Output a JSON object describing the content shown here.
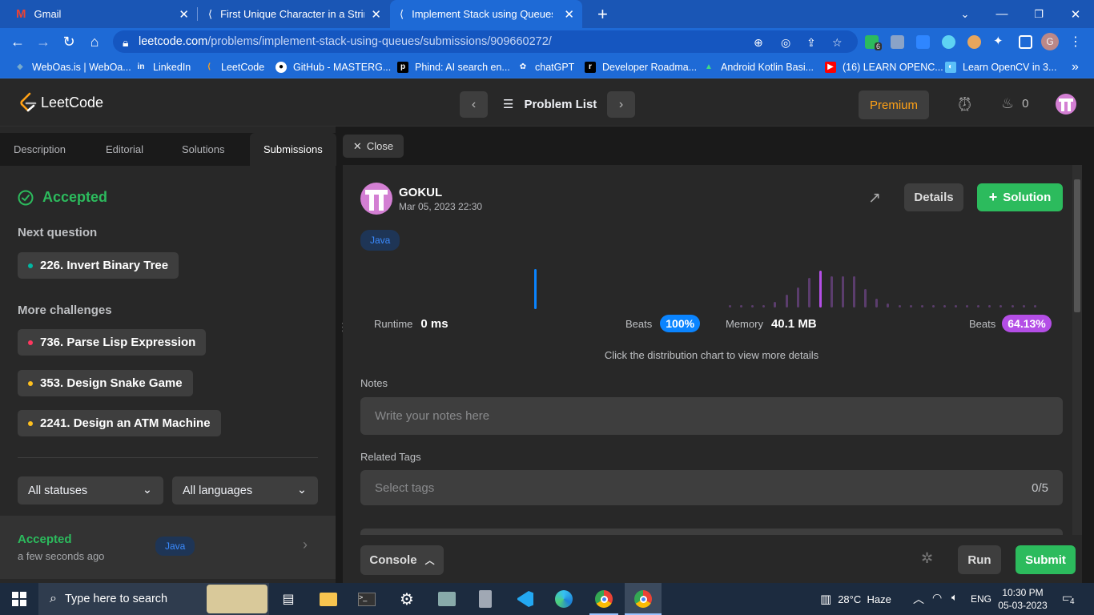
{
  "browser": {
    "tabs": [
      {
        "title": "Gmail"
      },
      {
        "title": "First Unique Character in a String"
      },
      {
        "title": "Implement Stack using Queues -"
      }
    ],
    "url_host": "leetcode.com",
    "url_path": "/problems/implement-stack-using-queues/submissions/909660272/",
    "extension_badge": "6",
    "profile_initial": "G",
    "bookmarks": [
      "WebOas.is | WebOa...",
      "LinkedIn",
      "LeetCode",
      "GitHub - MASTERG...",
      "Phind: AI search en...",
      "chatGPT",
      "Developer Roadma...",
      "Android Kotlin Basi...",
      "(16) LEARN OPENC...",
      "Learn OpenCV in 3..."
    ]
  },
  "header": {
    "logo": "LeetCode",
    "problem_list": "Problem List",
    "premium": "Premium",
    "streak": "0"
  },
  "left_panel": {
    "tabs": [
      "Description",
      "Editorial",
      "Solutions",
      "Submissions"
    ],
    "status": "Accepted",
    "next_question_heading": "Next question",
    "next_question": "226. Invert Binary Tree",
    "more_challenges_heading": "More challenges",
    "challenges": [
      {
        "label": "736. Parse Lisp Expression",
        "color": "#ff375f"
      },
      {
        "label": "353. Design Snake Game",
        "color": "#ffc01e"
      },
      {
        "label": "2241. Design an ATM Machine",
        "color": "#ffc01e"
      }
    ],
    "filter_status": "All statuses",
    "filter_language": "All languages",
    "submission": {
      "status": "Accepted",
      "time": "a few seconds ago",
      "language": "Java"
    }
  },
  "close_button": "Close",
  "submission_detail": {
    "user": "GOKUL",
    "date": "Mar 05, 2023 22:30",
    "details_button": "Details",
    "solution_button": "Solution",
    "language": "Java",
    "runtime_label": "Runtime",
    "runtime_value": "0 ms",
    "runtime_beats_label": "Beats",
    "runtime_beats": "100%",
    "memory_label": "Memory",
    "memory_value": "40.1 MB",
    "memory_beats_label": "Beats",
    "memory_beats": "64.13%",
    "chart_hint": "Click the distribution chart to view more details",
    "notes_label": "Notes",
    "notes_placeholder": "Write your notes here",
    "tags_label": "Related Tags",
    "tags_placeholder": "Select tags",
    "tags_count": "0/5"
  },
  "memory_distribution": [
    0.05,
    0.05,
    0.05,
    0.05,
    0.15,
    0.35,
    0.55,
    0.8,
    1.0,
    0.85,
    0.85,
    0.85,
    0.5,
    0.25,
    0.1,
    0.05,
    0.05,
    0.05,
    0.05,
    0.05,
    0.05,
    0.05,
    0.05,
    0.05,
    0.05,
    0.05,
    0.05,
    0.05
  ],
  "memory_highlight_index": 8,
  "bottom_bar": {
    "console": "Console",
    "run": "Run",
    "submit": "Submit"
  },
  "taskbar": {
    "search_placeholder": "Type here to search",
    "weather": "28°C  Haze",
    "language": "ENG",
    "time": "10:30 PM",
    "date": "05-03-2023",
    "notifications": "4"
  },
  "colors": {
    "accent_green": "#2cbb5d",
    "blue": "#0a84ff",
    "purple": "#b44ee6",
    "premium": "#ffa116"
  }
}
